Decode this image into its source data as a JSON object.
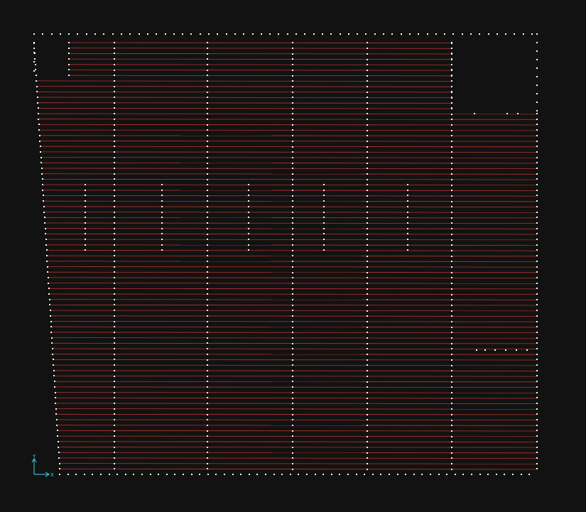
{
  "canvas": {
    "background": "#121212",
    "line_color": "#b4322a",
    "point_color": "#ffffff",
    "axis_color": "#3fd6e8"
  },
  "ucs_icon": {
    "x_label": "X",
    "y_label": "Y"
  },
  "drawing": {
    "description_visible": "",
    "line_count": 79,
    "hatch_columns": 6,
    "short_columns": 6
  }
}
